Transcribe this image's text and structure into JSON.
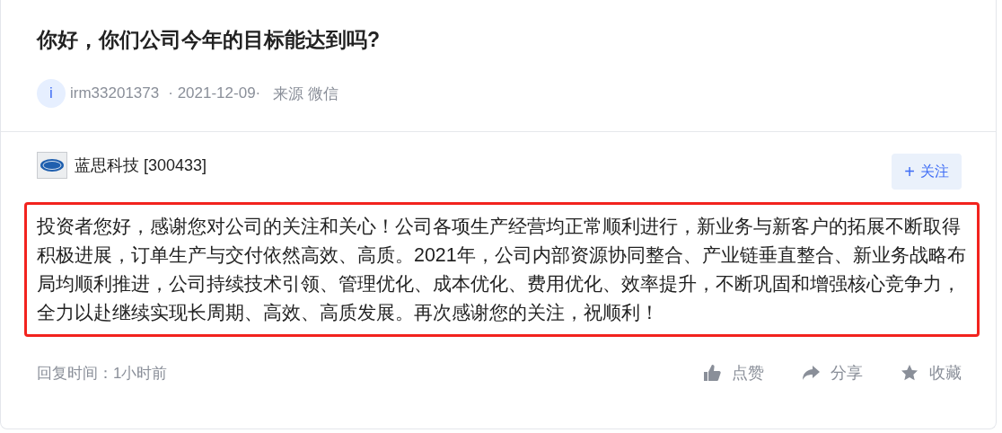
{
  "question": {
    "title": "你好，你们公司今年的目标能达到吗?",
    "avatar_letter": "i",
    "user": "irm33201373",
    "date": "· 2021-12-09·",
    "source": "来源 微信"
  },
  "answer": {
    "company": "蓝思科技 [300433]",
    "follow_button": {
      "icon": "+",
      "label": "关注"
    },
    "highlighted": true,
    "text": "投资者您好，感谢您对公司的关注和关心！公司各项生产经营均正常顺利进行，新业务与新客户的拓展不断取得积极进展，订单生产与交付依然高效、高质。2021年，公司内部资源协同整合、产业链垂直整合、新业务战略布局均顺利推进，公司持续技术引领、管理优化、成本优化、费用优化、效率提升，不断巩固和增强核心竞争力，全力以赴继续实现长周期、高效、高质发展。再次感谢您的关注，祝顺利！",
    "reply_time": "回复时间：1小时前",
    "actions": [
      {
        "kind": "like",
        "label": "点赞"
      },
      {
        "kind": "share",
        "label": "分享"
      },
      {
        "kind": "favorite",
        "label": "收藏"
      }
    ]
  }
}
